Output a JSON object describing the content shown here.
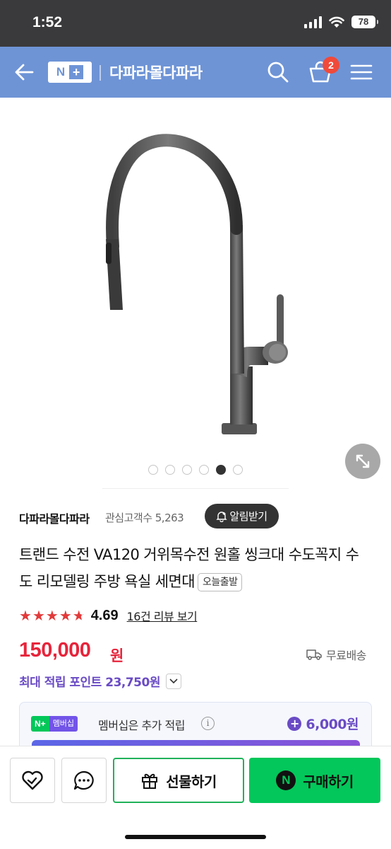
{
  "status_bar": {
    "time": "1:52",
    "battery": "78"
  },
  "header": {
    "logo_text": "N",
    "logo_plus": "+",
    "store_name": "다파라몰다파라",
    "cart_count": "2",
    "bg_color": "#6e94d6",
    "icons": [
      "back-arrow-icon",
      "search-icon",
      "cart-icon",
      "menu-icon"
    ]
  },
  "gallery": {
    "image_count": 6,
    "active_index": 4
  },
  "store": {
    "name": "다파라몰다파라",
    "interest_label": "관심고객수 5,263",
    "alert_label": "알림받기"
  },
  "product": {
    "title": "트랜드 수전 VA120 거위목수전 원홀 씽크대 수도꼭지 수도 리모델링 주방 욕실 세면대",
    "badge": "오늘출발",
    "rating": "4.69",
    "rating_stars": 4.69,
    "review_link": "16건 리뷰 보기",
    "price": "150,000",
    "price_unit": "원",
    "price_color": "#e7243b",
    "shipping": "무료배송",
    "max_points": "최대 적립 포인트 23,750원"
  },
  "membership": {
    "tag_np": "N+",
    "tag_ms": "멤버십",
    "text": "멤버십은 추가 적립",
    "info": "i",
    "points": "6,000원"
  },
  "bottom_bar": {
    "gift_label": "선물하기",
    "buy_label": "구매하기",
    "buy_n": "N",
    "accent": "#03c75a"
  }
}
